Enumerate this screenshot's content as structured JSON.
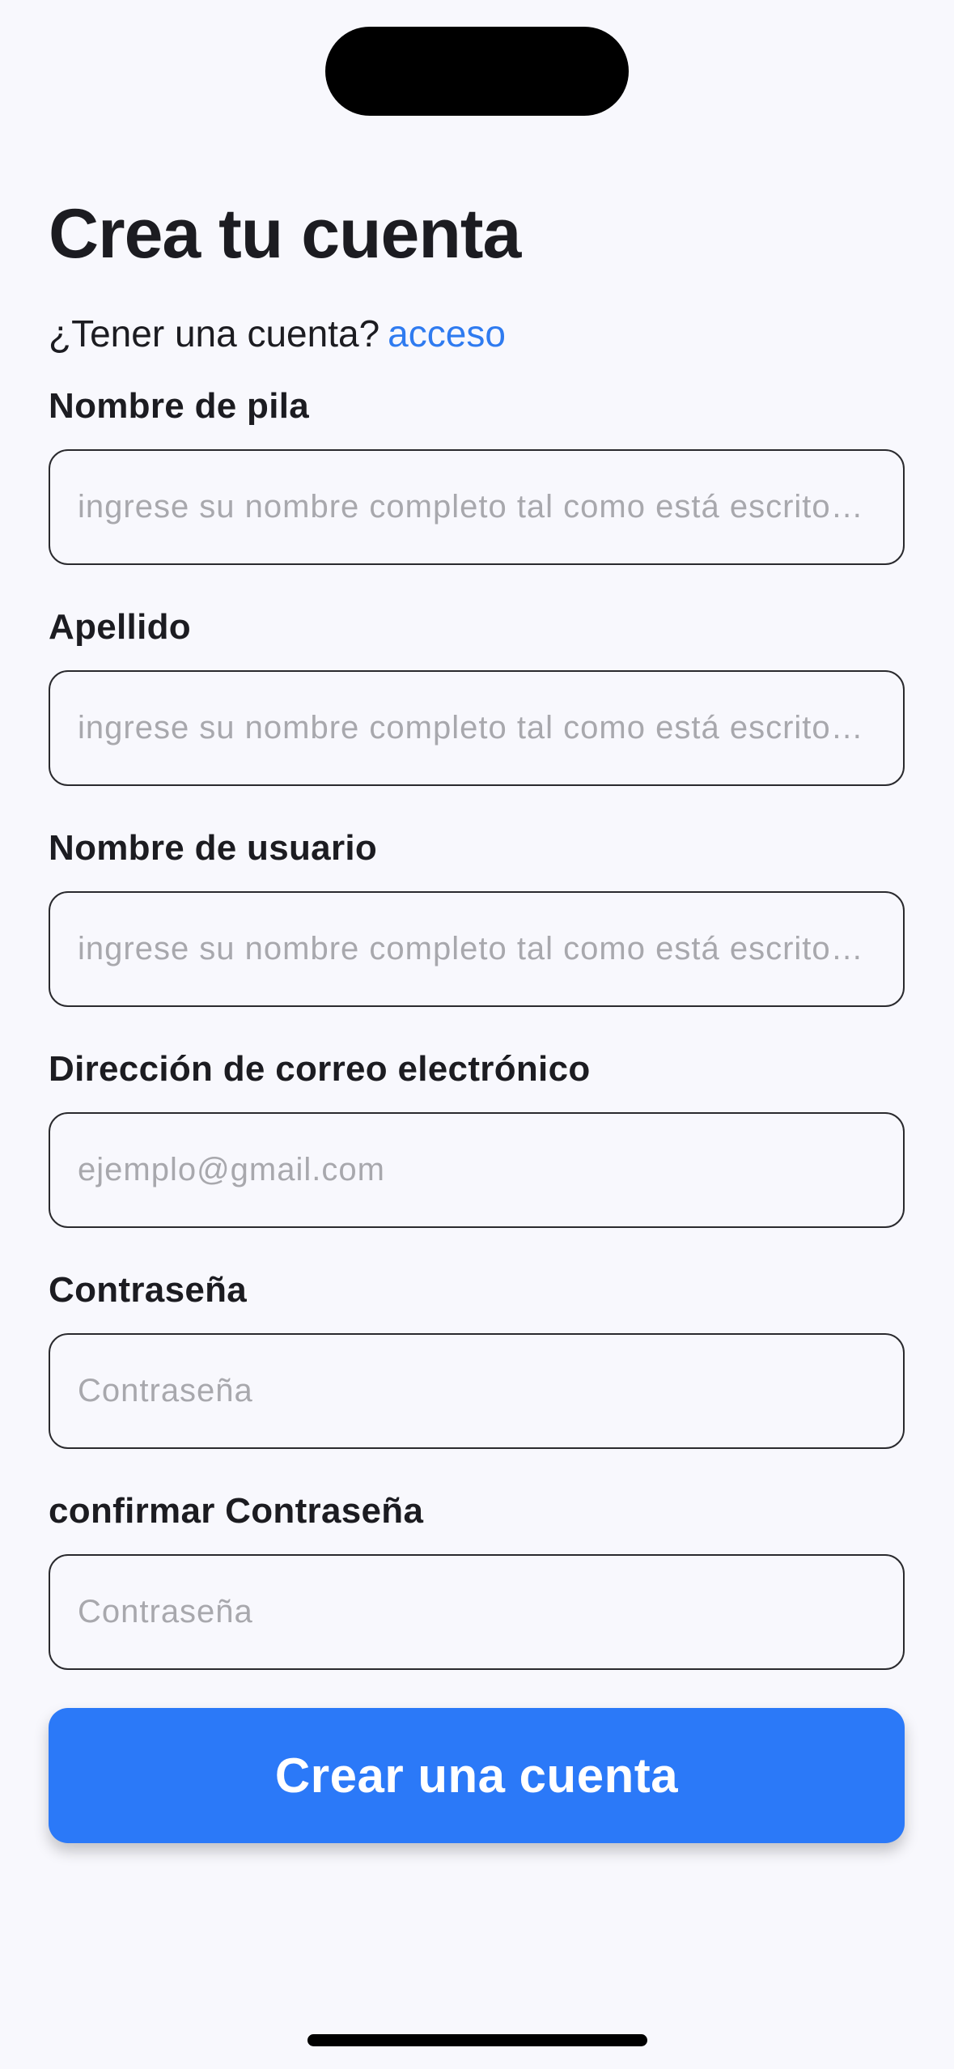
{
  "page": {
    "title": "Crea tu cuenta",
    "login_prompt": "¿Tener una cuenta?",
    "login_link": "acceso"
  },
  "form": {
    "first_name": {
      "label": "Nombre de pila",
      "placeholder": "ingrese su nombre completo tal como está escrito…",
      "value": ""
    },
    "last_name": {
      "label": "Apellido",
      "placeholder": "ingrese su nombre completo tal como está escrito…",
      "value": ""
    },
    "username": {
      "label": "Nombre de usuario",
      "placeholder": "ingrese su nombre completo tal como está escrito…",
      "value": ""
    },
    "email": {
      "label": "Dirección de correo electrónico",
      "placeholder": "ejemplo@gmail.com",
      "value": ""
    },
    "password": {
      "label": "Contraseña",
      "placeholder": "Contraseña",
      "value": ""
    },
    "confirm_password": {
      "label": "confirmar Contraseña",
      "placeholder": "Contraseña",
      "value": ""
    },
    "submit_label": "Crear una cuenta"
  },
  "colors": {
    "accent": "#2b79f8",
    "link": "#2f7bf0",
    "background": "#f8f8fd",
    "text": "#1c1c21",
    "placeholder": "#a8a8ad"
  }
}
